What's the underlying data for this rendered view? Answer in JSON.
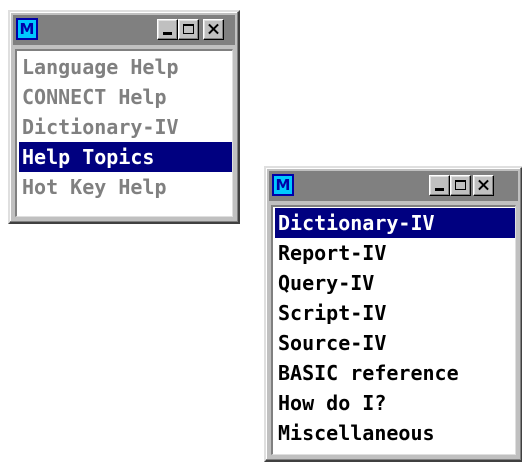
{
  "help_menu": {
    "icon_letter": "M",
    "icon": "app-m-icon",
    "buttons": [
      "minimize-icon",
      "maximize-icon",
      "close-icon"
    ],
    "items": [
      {
        "label": "Language Help",
        "selected": false
      },
      {
        "label": "CONNECT Help",
        "selected": false
      },
      {
        "label": "Dictionary-IV",
        "selected": false
      },
      {
        "label": "Help Topics",
        "selected": true
      },
      {
        "label": "Hot Key Help",
        "selected": false
      }
    ]
  },
  "topics_menu": {
    "icon_letter": "M",
    "icon": "app-m-icon",
    "buttons": [
      "minimize-icon",
      "maximize-icon",
      "close-icon"
    ],
    "items": [
      {
        "label": "Dictionary-IV",
        "selected": true
      },
      {
        "label": "Report-IV",
        "selected": false
      },
      {
        "label": "Query-IV",
        "selected": false
      },
      {
        "label": "Script-IV",
        "selected": false
      },
      {
        "label": "Source-IV",
        "selected": false
      },
      {
        "label": "BASIC reference",
        "selected": false
      },
      {
        "label": "How do I?",
        "selected": false
      },
      {
        "label": "Miscellaneous",
        "selected": false
      }
    ]
  },
  "colors": {
    "selection": "#000080",
    "disabled_text": "#808080",
    "titlebar_inactive": "#808080",
    "icon_fill": "#00c8ff"
  }
}
